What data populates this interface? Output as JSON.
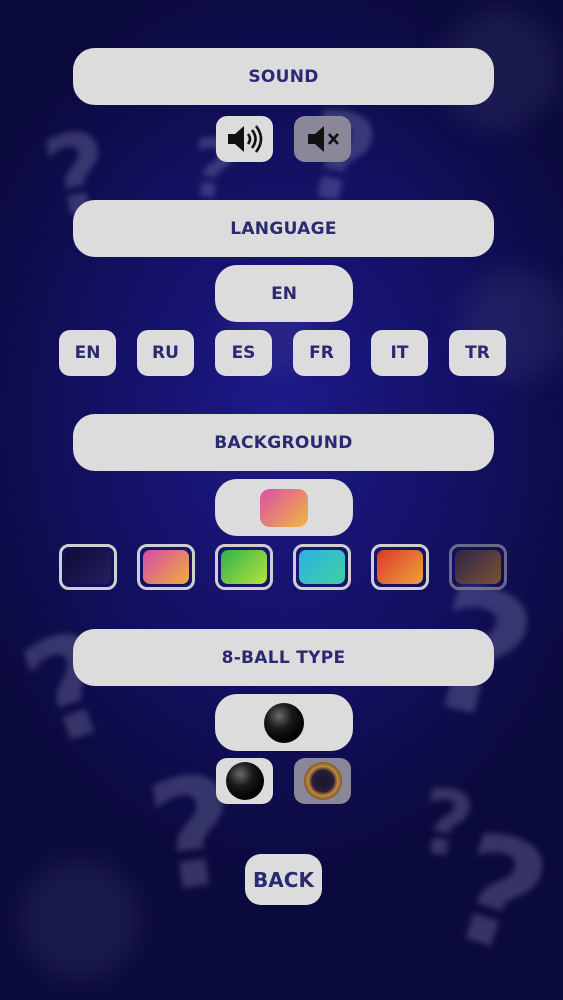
{
  "sections": {
    "sound": {
      "title": "SOUND"
    },
    "language": {
      "title": "LANGUAGE",
      "selected": "EN",
      "options": [
        "EN",
        "RU",
        "ES",
        "FR",
        "IT",
        "TR"
      ]
    },
    "background": {
      "title": "BACKGROUND",
      "selected_colors": [
        "#d94fa8",
        "#f2b640"
      ],
      "options": [
        {
          "name": "dark-navy",
          "colors": [
            "#0c0b38",
            "#23205f"
          ]
        },
        {
          "name": "pink-orange",
          "colors": [
            "#d34aa9",
            "#f1ae3d"
          ]
        },
        {
          "name": "green",
          "colors": [
            "#2fb24c",
            "#b6e33c"
          ]
        },
        {
          "name": "teal-blue",
          "colors": [
            "#2fb0e8",
            "#3fd0a0"
          ]
        },
        {
          "name": "red-orange",
          "colors": [
            "#d93a2a",
            "#f0a13a"
          ]
        },
        {
          "name": "brown",
          "colors": [
            "#3a2c3f",
            "#a06a2a"
          ]
        }
      ]
    },
    "ball": {
      "title": "8-BALL TYPE"
    }
  },
  "back": {
    "label": "BACK"
  },
  "icons": {
    "sound_on": "speaker-on-icon",
    "sound_off": "speaker-mute-icon",
    "ball_black": "black-ball-icon",
    "ball_bronze": "bronze-ball-icon"
  }
}
